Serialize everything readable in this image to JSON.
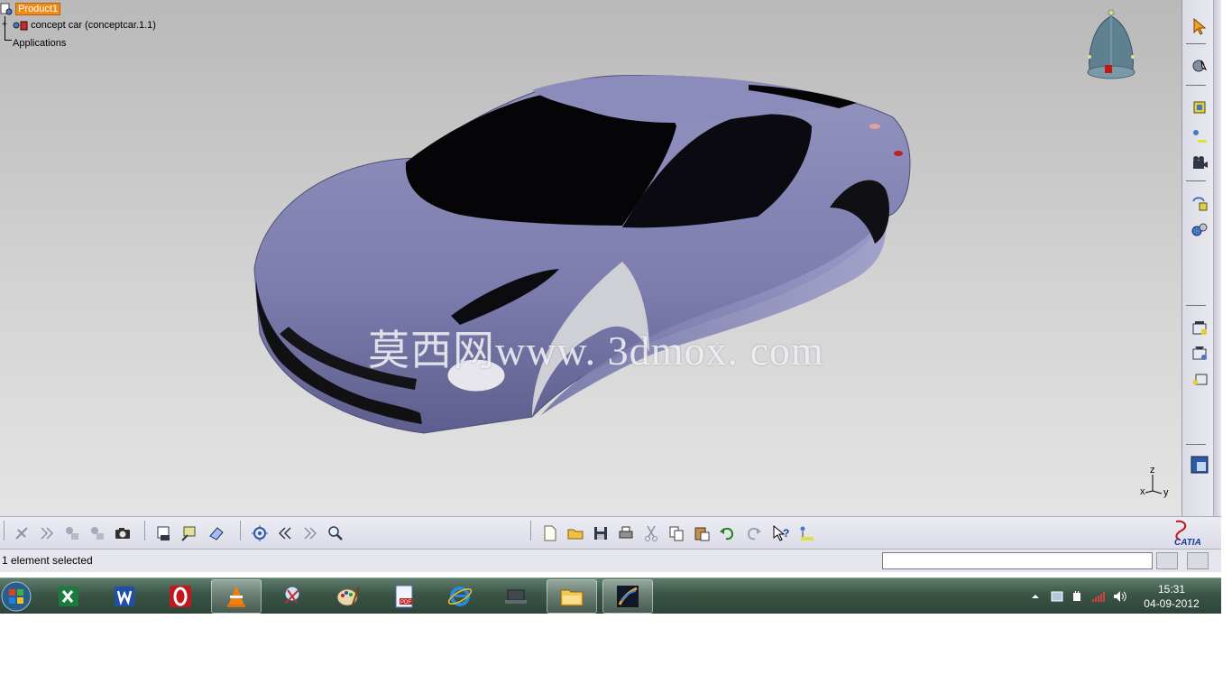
{
  "spec_tree": {
    "root": "Product1",
    "child": "concept car (conceptcar.1.1)",
    "applications": "Applications"
  },
  "viewport": {
    "watermark": "莫西网www. 3dmox. com",
    "axis_x": "x",
    "axis_y": "y",
    "axis_z": "z"
  },
  "right_toolbar": {
    "buttons": [
      "select-icon",
      "snap-icon",
      "new-product-icon",
      "insert-component-icon",
      "camera-icon",
      "replace-component-icon",
      "catalog-icon",
      "scenes-icon",
      "analysis-icon",
      "publication-icon",
      "view-icon"
    ]
  },
  "bottom_toolbar": {
    "buttons": [
      "fly-mode-icon",
      "next-icon",
      "copy-view-icon",
      "paste-view-icon",
      "capture-icon",
      "sketch-tracker-icon",
      "shop-icon",
      "eraser-icon",
      "fit-all-icon",
      "previous-icon",
      "forward-icon",
      "zoom-icon",
      "new-file-icon",
      "open-file-icon",
      "save-icon",
      "print-icon",
      "cut-icon",
      "copy-icon",
      "paste-icon",
      "undo-icon",
      "redo-icon",
      "whats-this-icon",
      "properties-icon"
    ],
    "logo_text": "CATIA"
  },
  "status_bar": {
    "message": "1 element selected",
    "command_value": ""
  },
  "taskbar": {
    "apps": [
      "excel-icon",
      "word-icon",
      "opera-icon",
      "vlc-icon",
      "snipping-tool-icon",
      "paint-icon",
      "pdf-icon",
      "internet-explorer-icon",
      "network-icon",
      "explorer-icon",
      "catia-icon"
    ],
    "time": "15:31",
    "date": "04-09-2012"
  },
  "colors": {
    "car_body": "#8a8ab8",
    "tree_highlight": "#f08c1a",
    "taskbar": "#3a5446"
  }
}
